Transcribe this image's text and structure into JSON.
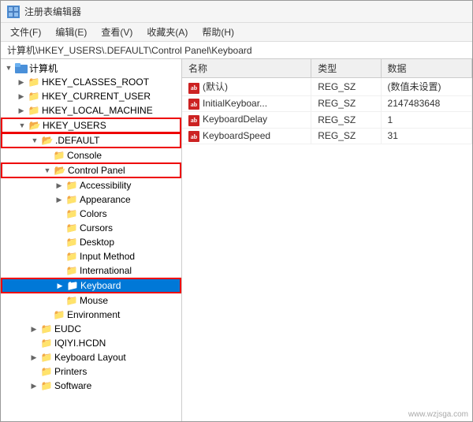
{
  "window": {
    "title": "注册表编辑器",
    "icon_label": "reg"
  },
  "menu": {
    "items": [
      "文件(F)",
      "编辑(E)",
      "查看(V)",
      "收藏夹(A)",
      "帮助(H)"
    ]
  },
  "address_bar": {
    "path": "计算机\\HKEY_USERS\\.DEFAULT\\Control Panel\\Keyboard"
  },
  "tree": {
    "nodes": [
      {
        "id": "computer",
        "label": "计算机",
        "level": 0,
        "expanded": true,
        "has_children": true,
        "selected": false
      },
      {
        "id": "hkcr",
        "label": "HKEY_CLASSES_ROOT",
        "level": 1,
        "expanded": false,
        "has_children": true,
        "selected": false
      },
      {
        "id": "hkcu",
        "label": "HKEY_CURRENT_USER",
        "level": 1,
        "expanded": false,
        "has_children": true,
        "selected": false
      },
      {
        "id": "hklm",
        "label": "HKEY_LOCAL_MACHINE",
        "level": 1,
        "expanded": false,
        "has_children": true,
        "selected": false
      },
      {
        "id": "hku",
        "label": "HKEY_USERS",
        "level": 1,
        "expanded": true,
        "has_children": true,
        "selected": false,
        "highlight": true
      },
      {
        "id": "default",
        "label": ".DEFAULT",
        "level": 2,
        "expanded": true,
        "has_children": true,
        "selected": false,
        "highlight": true
      },
      {
        "id": "console",
        "label": "Console",
        "level": 3,
        "expanded": false,
        "has_children": false,
        "selected": false
      },
      {
        "id": "controlpanel",
        "label": "Control Panel",
        "level": 3,
        "expanded": true,
        "has_children": true,
        "selected": false,
        "highlight": true
      },
      {
        "id": "accessibility",
        "label": "Accessibility",
        "level": 4,
        "expanded": false,
        "has_children": true,
        "selected": false
      },
      {
        "id": "appearance",
        "label": "Appearance",
        "level": 4,
        "expanded": false,
        "has_children": true,
        "selected": false
      },
      {
        "id": "colors",
        "label": "Colors",
        "level": 4,
        "expanded": false,
        "has_children": false,
        "selected": false
      },
      {
        "id": "cursors",
        "label": "Cursors",
        "level": 4,
        "expanded": false,
        "has_children": false,
        "selected": false
      },
      {
        "id": "desktop",
        "label": "Desktop",
        "level": 4,
        "expanded": false,
        "has_children": false,
        "selected": false
      },
      {
        "id": "inputmethod",
        "label": "Input Method",
        "level": 4,
        "expanded": false,
        "has_children": false,
        "selected": false
      },
      {
        "id": "international",
        "label": "International",
        "level": 4,
        "expanded": false,
        "has_children": false,
        "selected": false
      },
      {
        "id": "keyboard",
        "label": "Keyboard",
        "level": 4,
        "expanded": false,
        "has_children": false,
        "selected": true,
        "highlight": true
      },
      {
        "id": "mouse",
        "label": "Mouse",
        "level": 4,
        "expanded": false,
        "has_children": false,
        "selected": false
      },
      {
        "id": "environment",
        "label": "Environment",
        "level": 3,
        "expanded": false,
        "has_children": false,
        "selected": false
      },
      {
        "id": "eudc",
        "label": "EUDC",
        "level": 2,
        "expanded": false,
        "has_children": true,
        "selected": false
      },
      {
        "id": "iqiyi",
        "label": "IQIYI.HCDN",
        "level": 2,
        "expanded": false,
        "has_children": false,
        "selected": false
      },
      {
        "id": "keyboardlayout",
        "label": "Keyboard Layout",
        "level": 2,
        "expanded": false,
        "has_children": true,
        "selected": false
      },
      {
        "id": "printers",
        "label": "Printers",
        "level": 2,
        "expanded": false,
        "has_children": false,
        "selected": false
      },
      {
        "id": "software",
        "label": "Software",
        "level": 2,
        "expanded": false,
        "has_children": true,
        "selected": false
      }
    ]
  },
  "table": {
    "columns": [
      "名称",
      "类型",
      "数据"
    ],
    "rows": [
      {
        "name": "(默认)",
        "type": "REG_SZ",
        "data": "(数值未设置)",
        "icon": "ab"
      },
      {
        "name": "InitialKeyboar...",
        "type": "REG_SZ",
        "data": "2147483648",
        "icon": "ab"
      },
      {
        "name": "KeyboardDelay",
        "type": "REG_SZ",
        "data": "1",
        "icon": "ab"
      },
      {
        "name": "KeyboardSpeed",
        "type": "REG_SZ",
        "data": "31",
        "icon": "ab"
      }
    ]
  },
  "watermark": "www.wzjsga.com",
  "colors": {
    "accent": "#0078d7",
    "highlight_border": "#e00000",
    "folder_color": "#e8a020",
    "selected_bg": "#0078d7"
  }
}
